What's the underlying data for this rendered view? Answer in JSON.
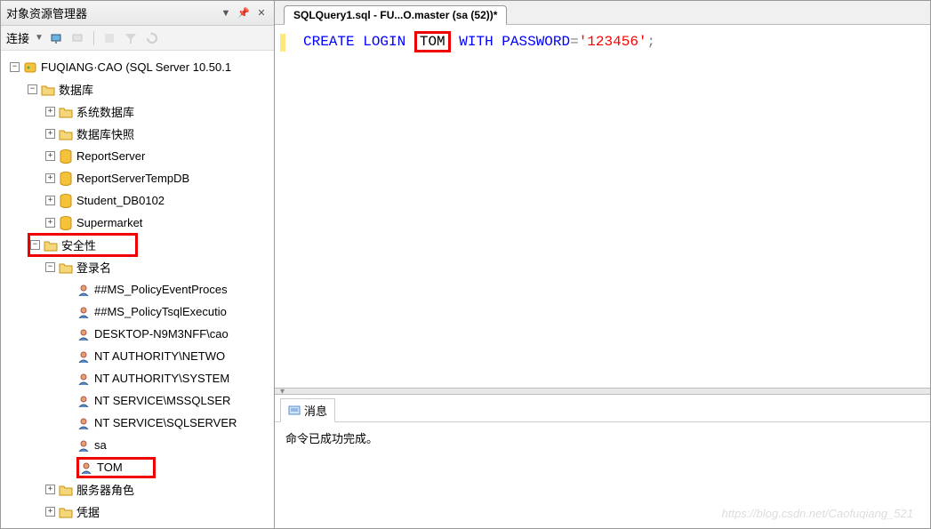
{
  "panel": {
    "title": "对象资源管理器",
    "connect_label": "连接"
  },
  "tree": {
    "root": "FUQIANG·CAO (SQL Server 10.50.1",
    "databases": "数据库",
    "sys_db": "系统数据库",
    "db_snapshot": "数据库快照",
    "db1": "ReportServer",
    "db2": "ReportServerTempDB",
    "db3": "Student_DB0102",
    "db4": "Supermarket",
    "security": "安全性",
    "logins": "登录名",
    "login_items": [
      "##MS_PolicyEventProces",
      "##MS_PolicyTsqlExecutio",
      "DESKTOP-N9M3NFF\\cao",
      "NT AUTHORITY\\NETWO",
      "NT AUTHORITY\\SYSTEM",
      "NT SERVICE\\MSSQLSER",
      "NT SERVICE\\SQLSERVER",
      "sa",
      "TOM"
    ],
    "server_roles": "服务器角色",
    "credentials": "凭据"
  },
  "tab": {
    "label": "SQLQuery1.sql - FU...O.master (sa (52))*"
  },
  "sql": {
    "create": "CREATE",
    "login": "LOGIN",
    "tom": "TOM",
    "with": "WITH",
    "password": "PASSWORD",
    "eq": "=",
    "value": "'123456'",
    "semi": ";"
  },
  "messages": {
    "tab_label": "消息",
    "body": "命令已成功完成。"
  },
  "watermark": "https://blog.csdn.net/Caofuqiang_521"
}
